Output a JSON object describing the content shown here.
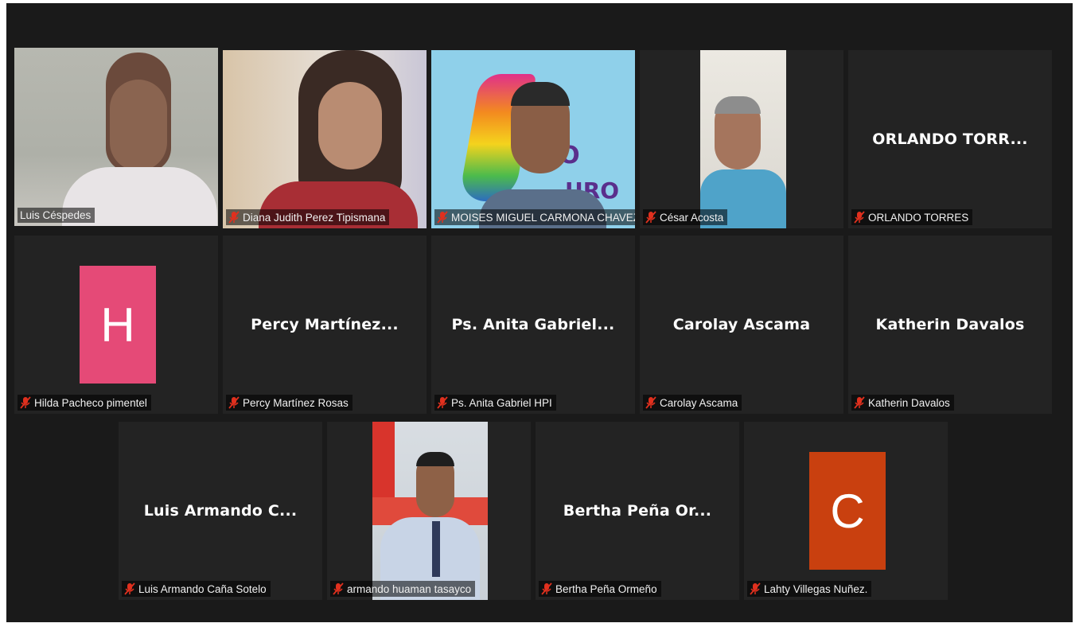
{
  "participants": [
    {
      "label": "Luis Céspedes",
      "muted": false,
      "active": true
    },
    {
      "label": "Diana Judith Perez Tipismana",
      "muted": true
    },
    {
      "label": "MOISES MIGUEL CARMONA CHAVEZ",
      "muted": true
    },
    {
      "label": "César Acosta",
      "muted": true
    },
    {
      "label": "ORLANDO TORRES",
      "display": "ORLANDO  TORR...",
      "muted": true
    },
    {
      "label": "Hilda Pacheco pimentel",
      "initial": "H",
      "avatar_color": "#e54a77",
      "muted": true
    },
    {
      "label": "Percy Martínez Rosas",
      "display": "Percy Martínez...",
      "muted": true
    },
    {
      "label": "Ps. Anita Gabriel HPI",
      "display": "Ps. Anita Gabriel...",
      "muted": true
    },
    {
      "label": "Carolay Ascama",
      "display": "Carolay Ascama",
      "muted": true
    },
    {
      "label": "Katherin Davalos",
      "display": "Katherin Davalos",
      "muted": true
    },
    {
      "label": "Luis Armando Caña Sotelo",
      "display": "Luis Armando C...",
      "muted": true
    },
    {
      "label": "armando huaman tasayco",
      "muted": true
    },
    {
      "label": "Bertha Peña Ormeño",
      "display": "Bertha Peña Or...",
      "muted": true
    },
    {
      "label": "Lahty Villegas Nuñez.",
      "initial": "C",
      "avatar_color": "#c9400f",
      "muted": true
    }
  ],
  "video_overlay_text": [
    "IO",
    "URO"
  ],
  "colors": {
    "active_border": "#d9e36f",
    "mic_muted": "#e0301e",
    "background": "#1a1a1a",
    "tile": "#232323"
  },
  "icons": {
    "muted": "mic-muted-icon"
  }
}
